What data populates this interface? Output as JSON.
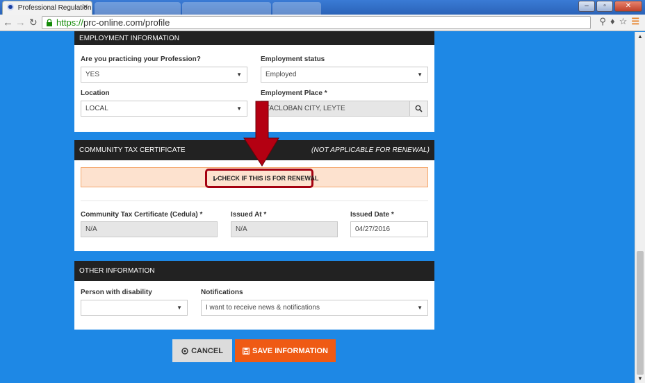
{
  "browser": {
    "tab_title": "Professional Regulation C",
    "tab_close": "✕",
    "ghost_tabs": [
      "",
      "",
      ""
    ],
    "url_protocol": "https://",
    "url_rest": "prc-online.com/profile"
  },
  "employment": {
    "header": "EMPLOYMENT INFORMATION",
    "practicing_label": "Are you practicing your Profession?",
    "practicing_value": "YES",
    "status_label": "Employment status",
    "status_value": "Employed",
    "location_label": "Location",
    "location_value": "LOCAL",
    "place_label": "Employment Place *",
    "place_value": "TACLOBAN CITY, LEYTE"
  },
  "ctc": {
    "header": "COMMUNITY TAX CERTIFICATE",
    "header_note": "(NOT APPLICABLE FOR RENEWAL)",
    "renewal_checkbox_label": "CHECK IF THIS IS FOR RENEWAL",
    "renewal_checked": true,
    "cedula_label": "Community Tax Certificate (Cedula) *",
    "cedula_value": "N/A",
    "issued_at_label": "Issued At *",
    "issued_at_value": "N/A",
    "issued_date_label": "Issued Date *",
    "issued_date_value": "04/27/2016"
  },
  "other": {
    "header": "OTHER INFORMATION",
    "disability_label": "Person with disability",
    "disability_value": "",
    "notifications_label": "Notifications",
    "notifications_value": "I want to receive news & notifications"
  },
  "actions": {
    "cancel_label": "CANCEL",
    "save_label": "SAVE INFORMATION"
  },
  "colors": {
    "page_bg": "#1e88e5",
    "header_bg": "#222222",
    "save_btn": "#ef5a14",
    "highlight_border": "#a40010"
  }
}
